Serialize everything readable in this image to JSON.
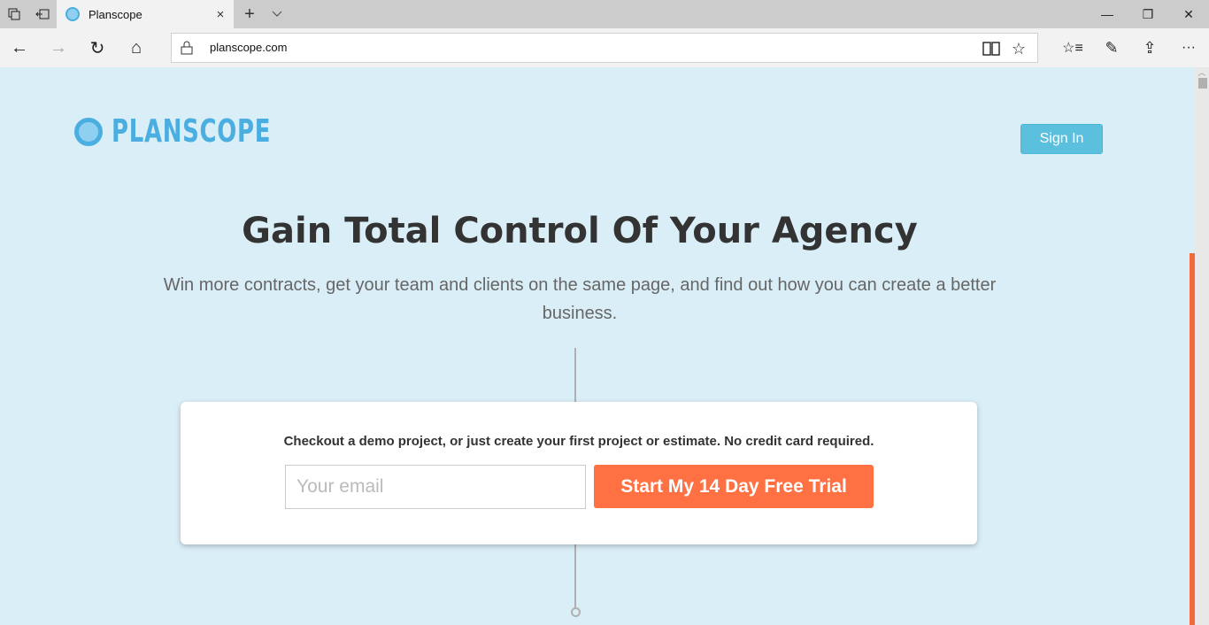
{
  "browser": {
    "tab": {
      "title": "Planscope",
      "close_icon": "×"
    },
    "new_tab_icon": "+",
    "tab_menu_icon": "⌵",
    "window_controls": {
      "minimize": "—",
      "restore": "❐",
      "close": "✕"
    },
    "nav": {
      "back": "←",
      "forward": "→",
      "refresh": "↻",
      "home": "⌂"
    },
    "address": {
      "url": "planscope.com"
    },
    "toolbar": {
      "reading_view": "📖",
      "favorite": "☆",
      "favorites_hub": "☆≡",
      "notes": "✎",
      "share": "⇪",
      "more": "···"
    }
  },
  "page": {
    "brand": {
      "name": "PLANSCOPE"
    },
    "header": {
      "sign_in_label": "Sign In"
    },
    "hero": {
      "title": "Gain Total Control Of Your Agency",
      "subtitle": "Win more contracts, get your team and clients on the same page, and find out how you can create a better business."
    },
    "signup": {
      "prompt": "Checkout a demo project, or just create your first project or estimate. No credit card required.",
      "email_placeholder": "Your email",
      "email_value": "",
      "cta_label": "Start My 14 Day Free Trial"
    },
    "colors": {
      "brand_blue": "#4aaee0",
      "signin_bg": "#5bc0de",
      "cta_orange": "#ff7043",
      "page_bg": "#daeef7"
    }
  }
}
